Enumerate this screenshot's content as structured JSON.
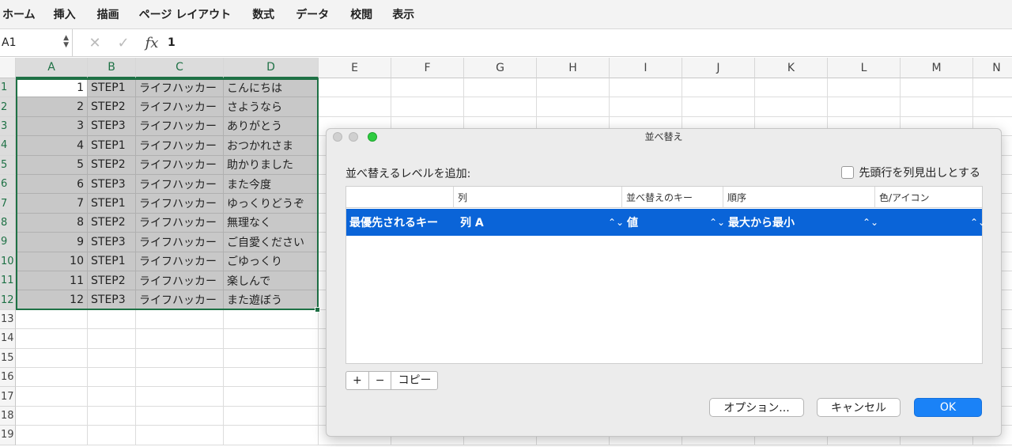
{
  "ribbon": {
    "tabs": [
      "ホーム",
      "挿入",
      "描画",
      "ページ レイアウト",
      "数式",
      "データ",
      "校閲",
      "表示"
    ]
  },
  "formula_bar": {
    "name_box": "A1",
    "cancel_icon": "✕",
    "enter_icon": "✓",
    "fx_label": "fx",
    "value": "1"
  },
  "grid": {
    "columns": [
      "A",
      "B",
      "C",
      "D",
      "E",
      "F",
      "G",
      "H",
      "I",
      "J",
      "K",
      "L",
      "M",
      "N"
    ],
    "rows": [
      "1",
      "2",
      "3",
      "4",
      "5",
      "6",
      "7",
      "8",
      "9",
      "10",
      "11",
      "12",
      "13",
      "14",
      "15",
      "16",
      "17",
      "18",
      "19"
    ],
    "data": [
      [
        "1",
        "STEP1",
        "ライフハッカー",
        "こんにちは"
      ],
      [
        "2",
        "STEP2",
        "ライフハッカー",
        "さようなら"
      ],
      [
        "3",
        "STEP3",
        "ライフハッカー",
        "ありがとう"
      ],
      [
        "4",
        "STEP1",
        "ライフハッカー",
        "おつかれさま"
      ],
      [
        "5",
        "STEP2",
        "ライフハッカー",
        "助かりました"
      ],
      [
        "6",
        "STEP3",
        "ライフハッカー",
        "また今度"
      ],
      [
        "7",
        "STEP1",
        "ライフハッカー",
        "ゆっくりどうぞ"
      ],
      [
        "8",
        "STEP2",
        "ライフハッカー",
        "無理なく"
      ],
      [
        "9",
        "STEP3",
        "ライフハッカー",
        "ご自愛ください"
      ],
      [
        "10",
        "STEP1",
        "ライフハッカー",
        "ごゆっくり"
      ],
      [
        "11",
        "STEP2",
        "ライフハッカー",
        "楽しんで"
      ],
      [
        "12",
        "STEP3",
        "ライフハッカー",
        "また遊ぼう"
      ]
    ]
  },
  "dialog": {
    "title": "並べ替え",
    "add_level_label": "並べ替えるレベルを追加:",
    "header_checkbox_label": "先頭行を列見出しとする",
    "columns": {
      "col1": "",
      "col2": "列",
      "col3": "並べ替えのキー",
      "col4": "順序",
      "col5": "色/アイコン"
    },
    "row": {
      "level": "最優先されるキー",
      "column": "列 A",
      "sort_on": "値",
      "order": "最大から最小",
      "color": ""
    },
    "buttons": {
      "add": "+",
      "remove": "−",
      "copy": "コピー",
      "options": "オプション...",
      "cancel": "キャンセル",
      "ok": "OK"
    }
  }
}
